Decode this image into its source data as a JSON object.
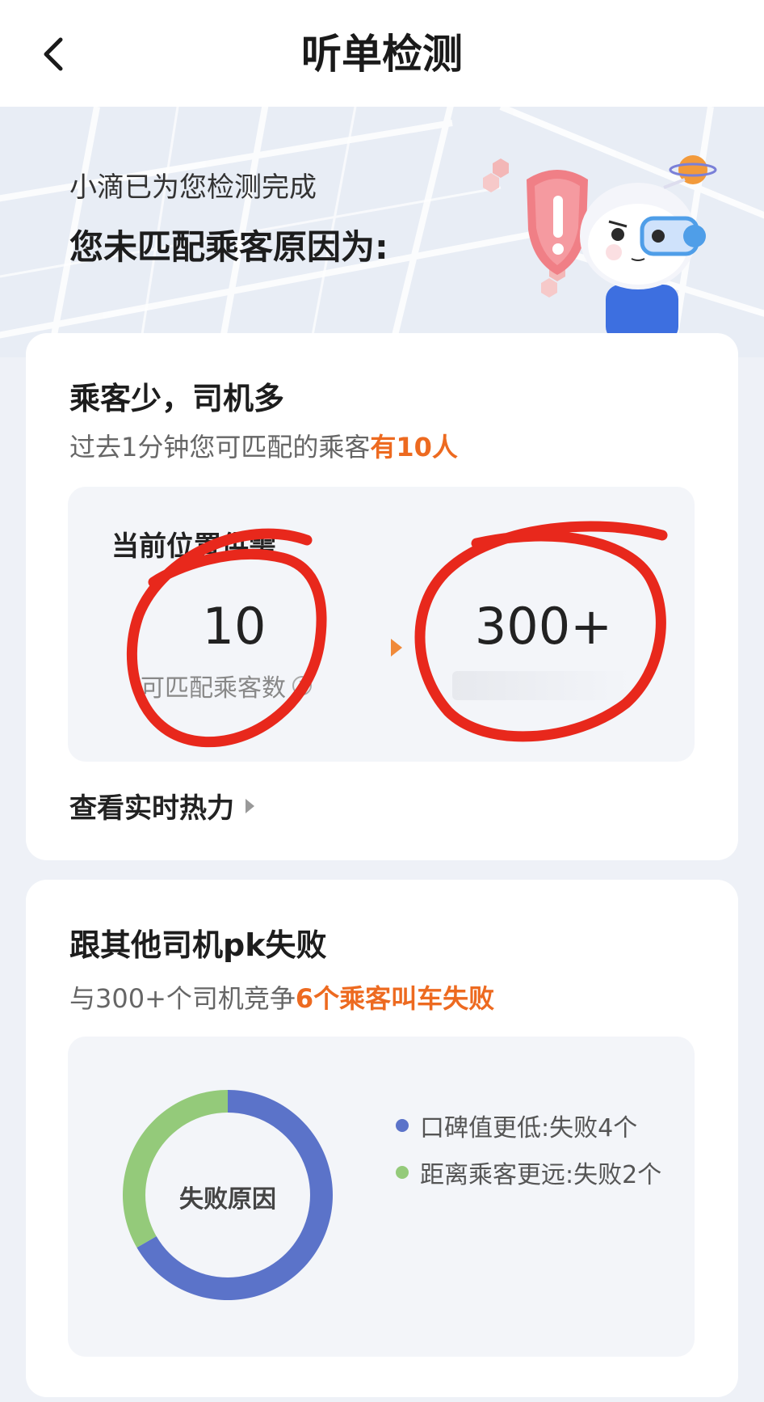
{
  "header": {
    "title": "听单检测"
  },
  "hero": {
    "subtitle": "小滴已为您检测完成",
    "headline": "您未匹配乘客原因为:"
  },
  "supply_card": {
    "title": "乘客少，司机多",
    "desc_prefix": "过去1分钟您可匹配的乘客",
    "desc_highlight": "有10人",
    "panel_title": "当前位置供需",
    "passenger_count": "10",
    "passenger_label": "可匹配乘客数",
    "driver_count": "300+",
    "heat_link": "查看实时热力"
  },
  "pk_card": {
    "title": "跟其他司机pk失败",
    "desc_prefix": "与300+个司机竞争",
    "desc_highlight": "6个乘客叫车失败",
    "donut_center": "失败原因",
    "legend": [
      {
        "label": "口碑值更低:失败4个",
        "color": "#5b73c9"
      },
      {
        "label": "距离乘客更远:失败2个",
        "color": "#94ca7a"
      }
    ]
  },
  "chart_data": {
    "type": "pie",
    "title": "失败原因",
    "categories": [
      "口碑值更低",
      "距离乘客更远"
    ],
    "values": [
      4,
      2
    ],
    "colors": [
      "#5b73c9",
      "#94ca7a"
    ]
  },
  "colors": {
    "accent": "#ed6a20",
    "annotation": "#e8281c"
  }
}
